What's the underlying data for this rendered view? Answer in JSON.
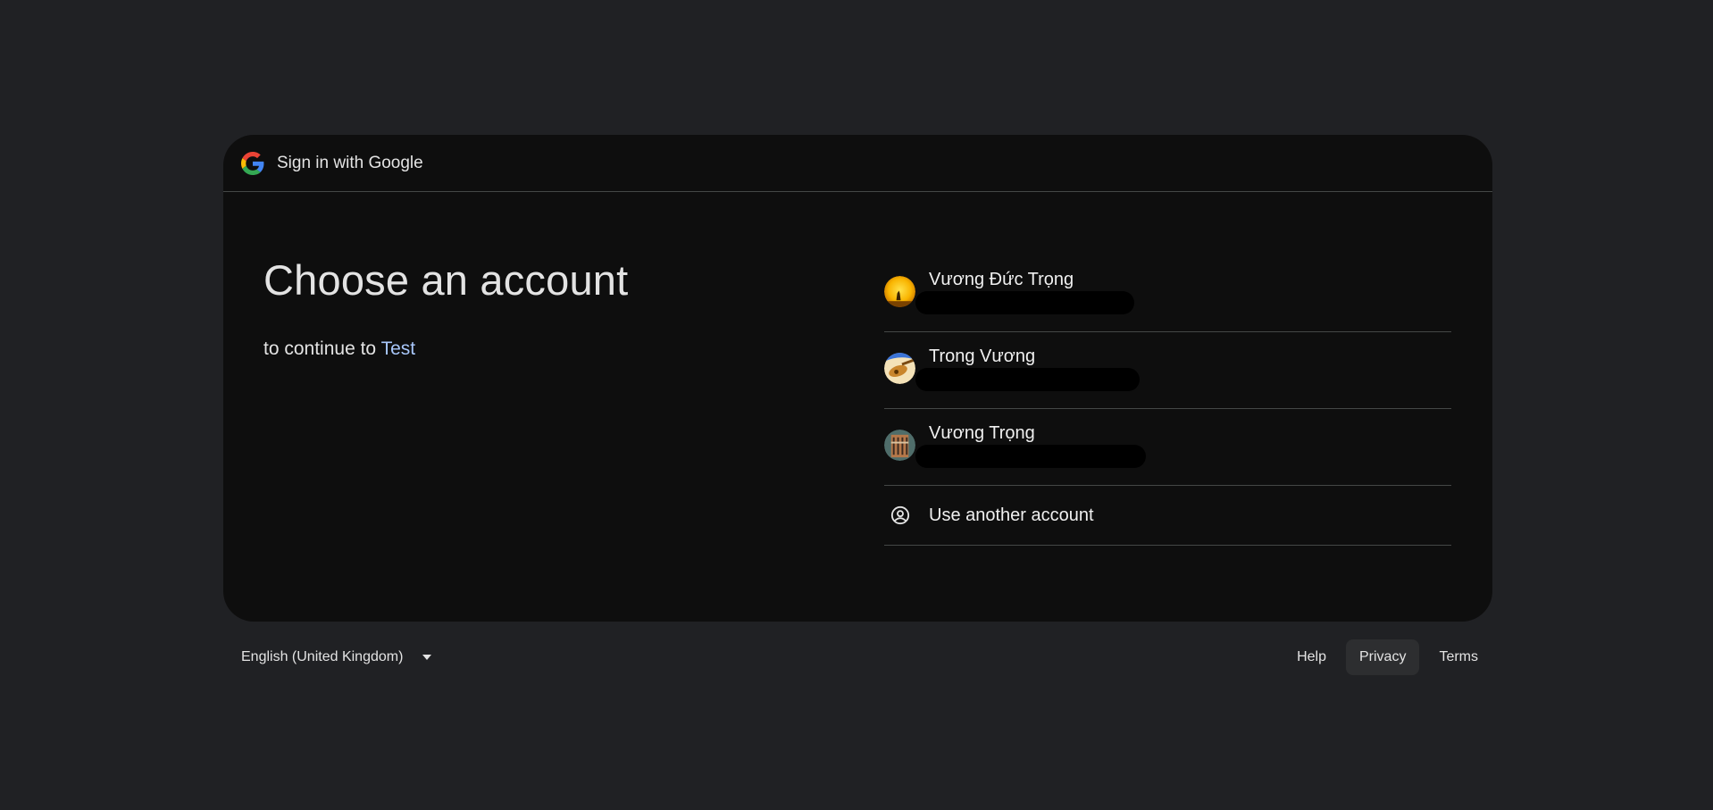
{
  "header": {
    "title": "Sign in with Google",
    "logo_icon": "google-g-icon"
  },
  "main": {
    "heading": "Choose an account",
    "subtitle_prefix": "to continue to ",
    "app_name": "Test"
  },
  "accounts": [
    {
      "name": "Vương Đức Trọng",
      "avatar_icon": "sunset-avatar"
    },
    {
      "name": "Trong Vương",
      "avatar_icon": "guitar-avatar"
    },
    {
      "name": "Vương Trọng",
      "avatar_icon": "building-avatar"
    }
  ],
  "use_another": {
    "label": "Use another account",
    "icon": "person-circle-icon"
  },
  "footer": {
    "language": "English (United Kingdom)",
    "links": [
      "Help",
      "Privacy",
      "Terms"
    ],
    "active_link": "Privacy"
  },
  "colors": {
    "page_bg": "#202124",
    "card_bg": "#0e0e0e",
    "link_accent": "#a8c7fa",
    "divider": "#444746"
  }
}
